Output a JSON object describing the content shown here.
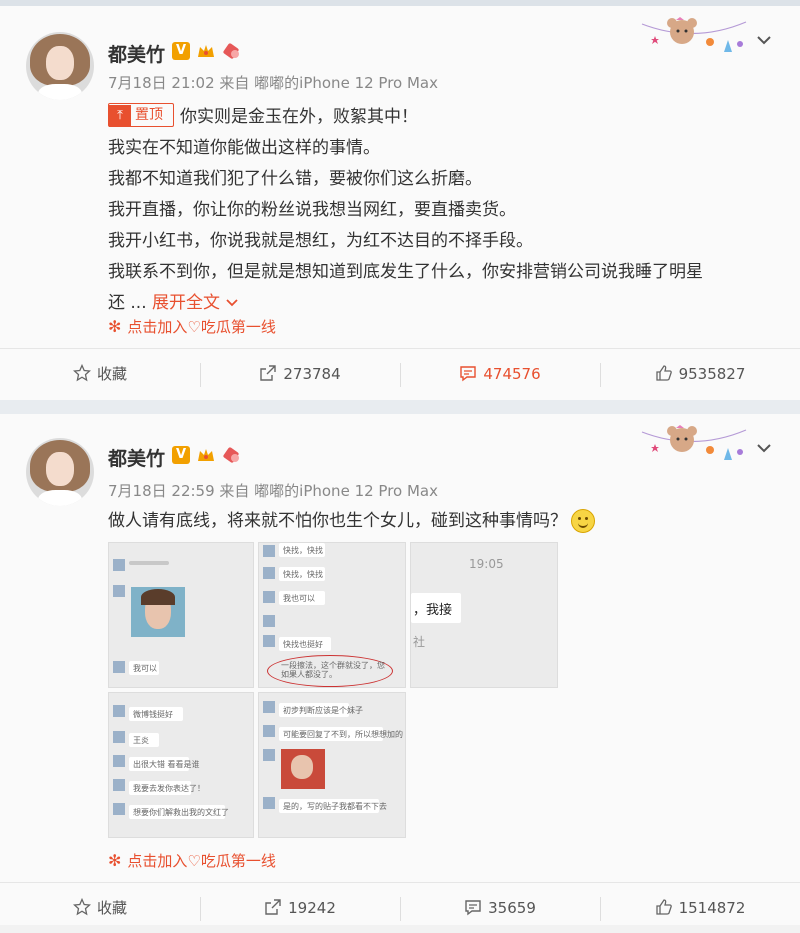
{
  "posts": [
    {
      "username": "都美竹",
      "vip_badge": "V",
      "meta": "7月18日 21:02 来自 嘟嘟的iPhone 12 Pro Max",
      "pin_label": "置顶",
      "lines": [
        "你实则是金玉在外，败絮其中！",
        "我实在不知道你能做出这样的事情。",
        "我都不知道我们犯了什么错，要被你们这么折磨。",
        "我开直播，你让你的粉丝说我想当网红，要直播卖货。",
        "我开小红书，你说我就是想红，为红不达目的不择手段。",
        "我联系不到你，但是就是想知道到底发生了什么，你安排营销公司说我睡了明星",
        "还 ..."
      ],
      "expand_label": "展开全文",
      "topic": "点击加入♡吃瓜第一线",
      "actions": {
        "fav": "收藏",
        "repost": "273784",
        "comment": "474576",
        "like": "9535827"
      }
    },
    {
      "username": "都美竹",
      "vip_badge": "V",
      "meta": "7月18日 22:59 来自 嘟嘟的iPhone 12 Pro Max",
      "text": "做人请有底线，将来就不怕你也生个女儿，碰到这种事情吗？",
      "topic": "点击加入♡吃瓜第一线",
      "actions": {
        "fav": "收藏",
        "repost": "19242",
        "comment": "35659",
        "like": "1514872"
      }
    }
  ],
  "screenshots": {
    "a_lines": [
      "我可以"
    ],
    "b_lines": [
      "快找，快找",
      "快找，快找",
      "我也可以",
      "快找也挺好",
      "一段擦法，这个群就没了，您如果人都没了。"
    ],
    "c_time": "19:05",
    "c_text": "，我接",
    "c_sub": "社",
    "d_lines": [
      "微博钱挺好",
      "王炎",
      "出很大错 看看是谁",
      "我要去发你表达了！",
      "想要你们解救出我的文红了"
    ],
    "e_lines": [
      "初步判断应该是个妹子",
      "可能要回复了不到，所以想想加的",
      "是的，写的贴子我都看不下去"
    ]
  },
  "colors": {
    "accent": "#e8502f",
    "vip": "#f2a000",
    "text": "#333333",
    "meta": "#888888"
  },
  "icons": {
    "fav": "star-icon",
    "repost": "share-icon",
    "comment": "comment-icon",
    "like": "thumbs-up-icon",
    "menu": "chevron-down-icon"
  }
}
